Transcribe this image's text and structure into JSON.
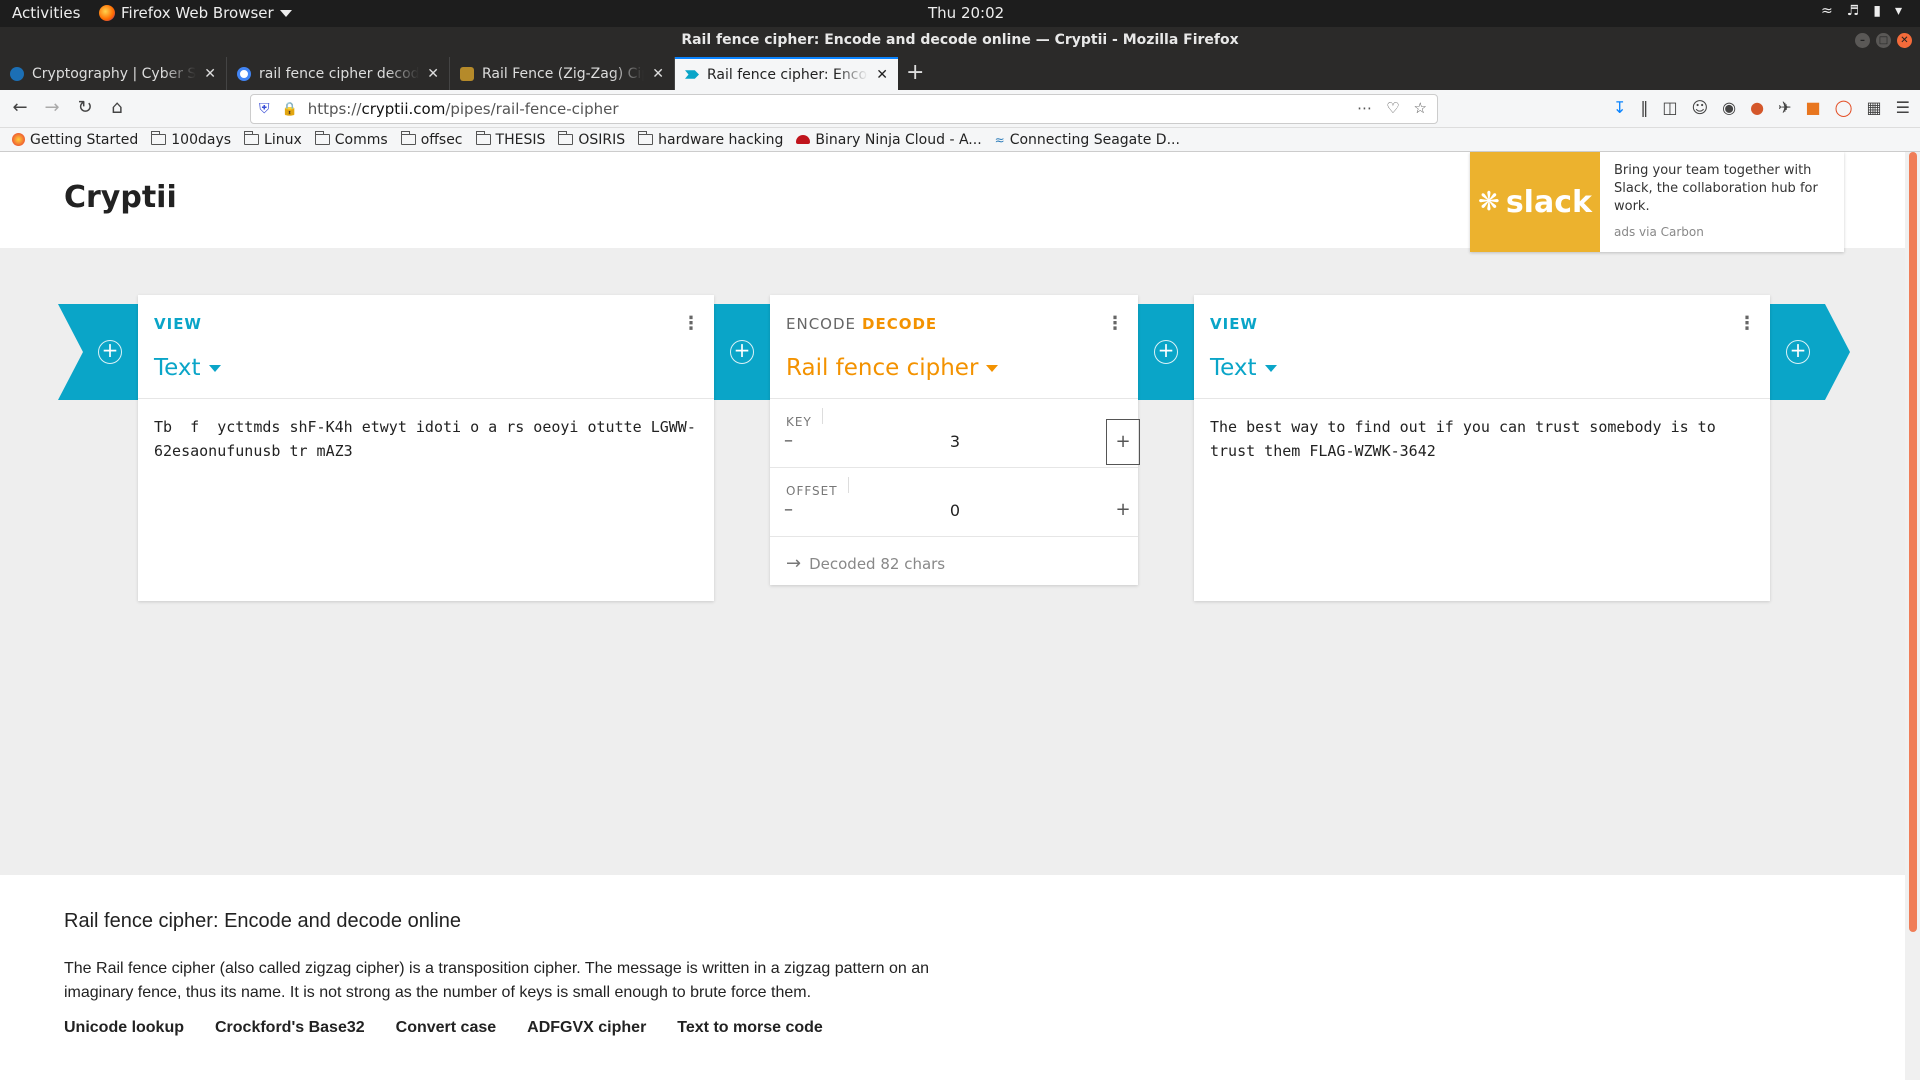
{
  "system": {
    "activities": "Activities",
    "app_name": "Firefox Web Browser",
    "clock": "Thu 20:02",
    "title": "Rail fence cipher: Encode and decode online — Cryptii - Mozilla Firefox"
  },
  "tabs": [
    {
      "label": "Cryptography | Cyber Sk",
      "icon_color": "#1c6fb5"
    },
    {
      "label": "rail fence cipher decode",
      "icon_color": "#4285f4"
    },
    {
      "label": "Rail Fence (Zig-Zag) Ciph",
      "icon_color": "#b58a2a"
    },
    {
      "label": "Rail fence cipher: Encode",
      "icon_color": "#0aa5c8"
    }
  ],
  "url": {
    "prefix": "https://",
    "host": "cryptii.com",
    "path": "/pipes/rail-fence-cipher"
  },
  "bookmarks": [
    {
      "label": "Getting Started",
      "type": "ff"
    },
    {
      "label": "100days",
      "type": "folder"
    },
    {
      "label": "Linux",
      "type": "folder"
    },
    {
      "label": "Comms",
      "type": "folder"
    },
    {
      "label": "offsec",
      "type": "folder"
    },
    {
      "label": "THESIS",
      "type": "folder"
    },
    {
      "label": "OSIRIS",
      "type": "folder"
    },
    {
      "label": "hardware hacking",
      "type": "folder"
    },
    {
      "label": "Binary Ninja Cloud - A...",
      "type": "site"
    },
    {
      "label": "Connecting Seagate D...",
      "type": "site2"
    }
  ],
  "site": {
    "brand": "Cryptii",
    "ad": {
      "logo_text": "slack",
      "text": "Bring your team together with Slack, the collaboration hub for work.",
      "via": "ads via Carbon"
    }
  },
  "left_panel": {
    "header": "VIEW",
    "selector": "Text",
    "content": "Tb  f  ycttmds shF-K4h etwyt idoti o a rs oeoyi otutte LGWW-62esaonufunusb tr mAZ3"
  },
  "middle_panel": {
    "encode_label": "ENCODE",
    "decode_label": "DECODE",
    "selector": "Rail fence cipher",
    "key_label": "KEY",
    "key_value": "3",
    "offset_label": "OFFSET",
    "offset_value": "0",
    "status": "Decoded 82 chars"
  },
  "right_panel": {
    "header": "VIEW",
    "selector": "Text",
    "content": "The best way to find out if you can trust somebody is to trust them FLAG-WZWK-3642"
  },
  "description": {
    "title": "Rail fence cipher: Encode and decode online",
    "text": "The Rail fence cipher (also called zigzag cipher) is a transposition cipher. The message is written in a zigzag pattern on an imaginary fence, thus its name. It is not strong as the number of keys is small enough to brute force them.",
    "links": [
      "Unicode lookup",
      "Crockford's Base32",
      "Convert case",
      "ADFGVX cipher",
      "Text to morse code"
    ]
  }
}
